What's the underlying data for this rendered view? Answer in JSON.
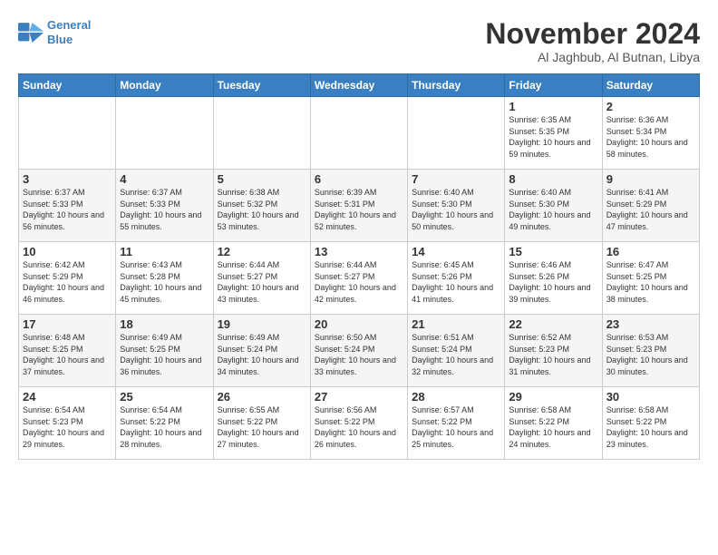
{
  "logo": {
    "line1": "General",
    "line2": "Blue"
  },
  "title": "November 2024",
  "subtitle": "Al Jaghbub, Al Butnan, Libya",
  "weekdays": [
    "Sunday",
    "Monday",
    "Tuesday",
    "Wednesday",
    "Thursday",
    "Friday",
    "Saturday"
  ],
  "weeks": [
    [
      {
        "day": "",
        "info": ""
      },
      {
        "day": "",
        "info": ""
      },
      {
        "day": "",
        "info": ""
      },
      {
        "day": "",
        "info": ""
      },
      {
        "day": "",
        "info": ""
      },
      {
        "day": "1",
        "info": "Sunrise: 6:35 AM\nSunset: 5:35 PM\nDaylight: 10 hours and 59 minutes."
      },
      {
        "day": "2",
        "info": "Sunrise: 6:36 AM\nSunset: 5:34 PM\nDaylight: 10 hours and 58 minutes."
      }
    ],
    [
      {
        "day": "3",
        "info": "Sunrise: 6:37 AM\nSunset: 5:33 PM\nDaylight: 10 hours and 56 minutes."
      },
      {
        "day": "4",
        "info": "Sunrise: 6:37 AM\nSunset: 5:33 PM\nDaylight: 10 hours and 55 minutes."
      },
      {
        "day": "5",
        "info": "Sunrise: 6:38 AM\nSunset: 5:32 PM\nDaylight: 10 hours and 53 minutes."
      },
      {
        "day": "6",
        "info": "Sunrise: 6:39 AM\nSunset: 5:31 PM\nDaylight: 10 hours and 52 minutes."
      },
      {
        "day": "7",
        "info": "Sunrise: 6:40 AM\nSunset: 5:30 PM\nDaylight: 10 hours and 50 minutes."
      },
      {
        "day": "8",
        "info": "Sunrise: 6:40 AM\nSunset: 5:30 PM\nDaylight: 10 hours and 49 minutes."
      },
      {
        "day": "9",
        "info": "Sunrise: 6:41 AM\nSunset: 5:29 PM\nDaylight: 10 hours and 47 minutes."
      }
    ],
    [
      {
        "day": "10",
        "info": "Sunrise: 6:42 AM\nSunset: 5:29 PM\nDaylight: 10 hours and 46 minutes."
      },
      {
        "day": "11",
        "info": "Sunrise: 6:43 AM\nSunset: 5:28 PM\nDaylight: 10 hours and 45 minutes."
      },
      {
        "day": "12",
        "info": "Sunrise: 6:44 AM\nSunset: 5:27 PM\nDaylight: 10 hours and 43 minutes."
      },
      {
        "day": "13",
        "info": "Sunrise: 6:44 AM\nSunset: 5:27 PM\nDaylight: 10 hours and 42 minutes."
      },
      {
        "day": "14",
        "info": "Sunrise: 6:45 AM\nSunset: 5:26 PM\nDaylight: 10 hours and 41 minutes."
      },
      {
        "day": "15",
        "info": "Sunrise: 6:46 AM\nSunset: 5:26 PM\nDaylight: 10 hours and 39 minutes."
      },
      {
        "day": "16",
        "info": "Sunrise: 6:47 AM\nSunset: 5:25 PM\nDaylight: 10 hours and 38 minutes."
      }
    ],
    [
      {
        "day": "17",
        "info": "Sunrise: 6:48 AM\nSunset: 5:25 PM\nDaylight: 10 hours and 37 minutes."
      },
      {
        "day": "18",
        "info": "Sunrise: 6:49 AM\nSunset: 5:25 PM\nDaylight: 10 hours and 36 minutes."
      },
      {
        "day": "19",
        "info": "Sunrise: 6:49 AM\nSunset: 5:24 PM\nDaylight: 10 hours and 34 minutes."
      },
      {
        "day": "20",
        "info": "Sunrise: 6:50 AM\nSunset: 5:24 PM\nDaylight: 10 hours and 33 minutes."
      },
      {
        "day": "21",
        "info": "Sunrise: 6:51 AM\nSunset: 5:24 PM\nDaylight: 10 hours and 32 minutes."
      },
      {
        "day": "22",
        "info": "Sunrise: 6:52 AM\nSunset: 5:23 PM\nDaylight: 10 hours and 31 minutes."
      },
      {
        "day": "23",
        "info": "Sunrise: 6:53 AM\nSunset: 5:23 PM\nDaylight: 10 hours and 30 minutes."
      }
    ],
    [
      {
        "day": "24",
        "info": "Sunrise: 6:54 AM\nSunset: 5:23 PM\nDaylight: 10 hours and 29 minutes."
      },
      {
        "day": "25",
        "info": "Sunrise: 6:54 AM\nSunset: 5:22 PM\nDaylight: 10 hours and 28 minutes."
      },
      {
        "day": "26",
        "info": "Sunrise: 6:55 AM\nSunset: 5:22 PM\nDaylight: 10 hours and 27 minutes."
      },
      {
        "day": "27",
        "info": "Sunrise: 6:56 AM\nSunset: 5:22 PM\nDaylight: 10 hours and 26 minutes."
      },
      {
        "day": "28",
        "info": "Sunrise: 6:57 AM\nSunset: 5:22 PM\nDaylight: 10 hours and 25 minutes."
      },
      {
        "day": "29",
        "info": "Sunrise: 6:58 AM\nSunset: 5:22 PM\nDaylight: 10 hours and 24 minutes."
      },
      {
        "day": "30",
        "info": "Sunrise: 6:58 AM\nSunset: 5:22 PM\nDaylight: 10 hours and 23 minutes."
      }
    ]
  ]
}
